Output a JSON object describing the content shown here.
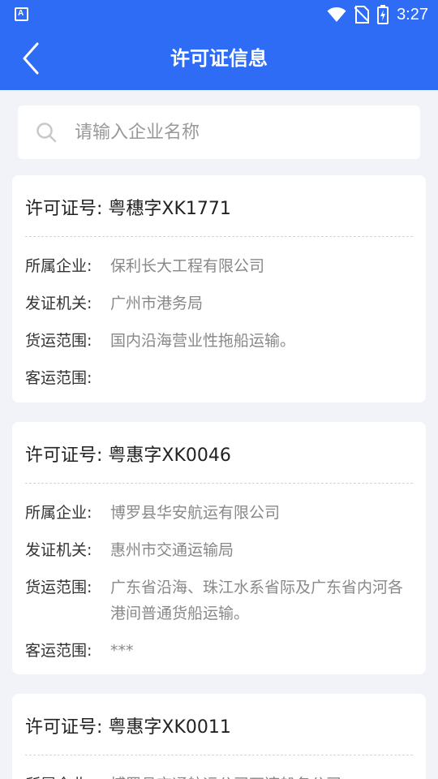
{
  "status_bar": {
    "left_icon_letter": "A",
    "time": "3:27",
    "icons": [
      "wifi-icon",
      "no-sim-icon",
      "battery-charging-icon"
    ]
  },
  "header": {
    "title": "许可证信息",
    "back_icon": "chevron-left-icon"
  },
  "search": {
    "placeholder": "请输入企业名称",
    "value": "",
    "icon": "search-icon"
  },
  "labels": {
    "license_no": "许可证号:",
    "company": "所属企业:",
    "authority": "发证机关:",
    "cargo_scope": "货运范围:",
    "passenger_scope": "客运范围:"
  },
  "licenses": [
    {
      "license_no": "粤穗字XK1771",
      "company": "保利长大工程有限公司",
      "authority": "广州市港务局",
      "cargo_scope": "国内沿海营业性拖船运输。",
      "passenger_scope": ""
    },
    {
      "license_no": "粤惠字XK0046",
      "company": "博罗县华安航运有限公司",
      "authority": "惠州市交通运输局",
      "cargo_scope": "广东省沿海、珠江水系省际及广东省内河各港间普通货船运输。",
      "passenger_scope": "***"
    },
    {
      "license_no": "粤惠字XK0011",
      "company": "博罗县交通航运公司石湾船务公司"
    }
  ]
}
